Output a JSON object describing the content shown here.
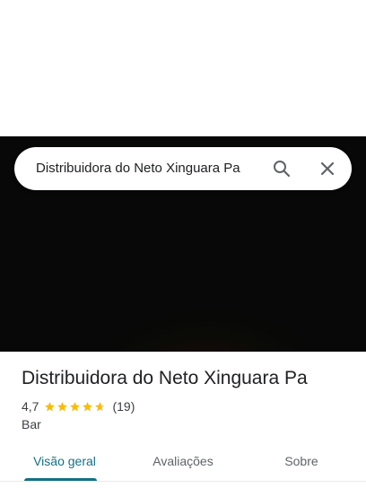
{
  "search": {
    "query": "Distribuidora do Neto Xinguara Pa",
    "search_icon": "search-icon",
    "close_icon": "close-icon"
  },
  "hero": {
    "description_visible": false
  },
  "place": {
    "name": "Distribuidora do Neto Xinguara Pa",
    "rating": "4,7",
    "rating_value": 4.7,
    "stars_total": 5,
    "review_count": "(19)",
    "category": "Bar"
  },
  "tabs": [
    {
      "label": "Visão geral",
      "selected": true
    },
    {
      "label": "Avaliações",
      "selected": false
    },
    {
      "label": "Sobre",
      "selected": false
    }
  ],
  "colors": {
    "accent": "#137085",
    "star": "#fbbc04",
    "text_primary": "#202124",
    "text_secondary": "#5f6368"
  }
}
